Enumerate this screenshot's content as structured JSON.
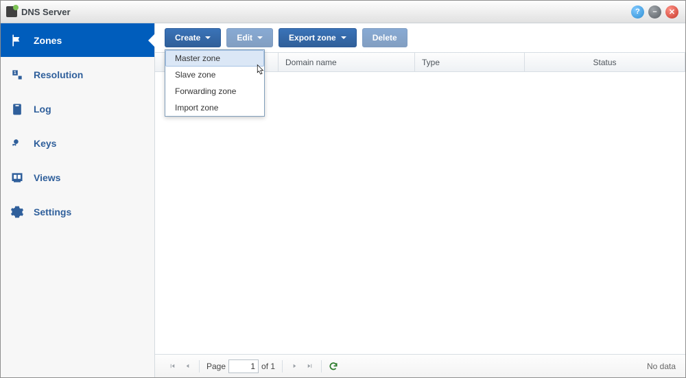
{
  "app": {
    "title": "DNS Server"
  },
  "sidebar": {
    "items": [
      {
        "label": "Zones"
      },
      {
        "label": "Resolution"
      },
      {
        "label": "Log"
      },
      {
        "label": "Keys"
      },
      {
        "label": "Views"
      },
      {
        "label": "Settings"
      }
    ]
  },
  "toolbar": {
    "create": "Create",
    "edit": "Edit",
    "export": "Export zone",
    "delete": "Delete"
  },
  "create_menu": {
    "items": [
      {
        "label": "Master zone"
      },
      {
        "label": "Slave zone"
      },
      {
        "label": "Forwarding zone"
      },
      {
        "label": "Import zone"
      }
    ]
  },
  "table": {
    "columns": {
      "c2": "Domain name",
      "c3": "Type",
      "c4": "Status"
    }
  },
  "pager": {
    "page_label": "Page",
    "current": "1",
    "of_label": "of 1",
    "status": "No data"
  }
}
